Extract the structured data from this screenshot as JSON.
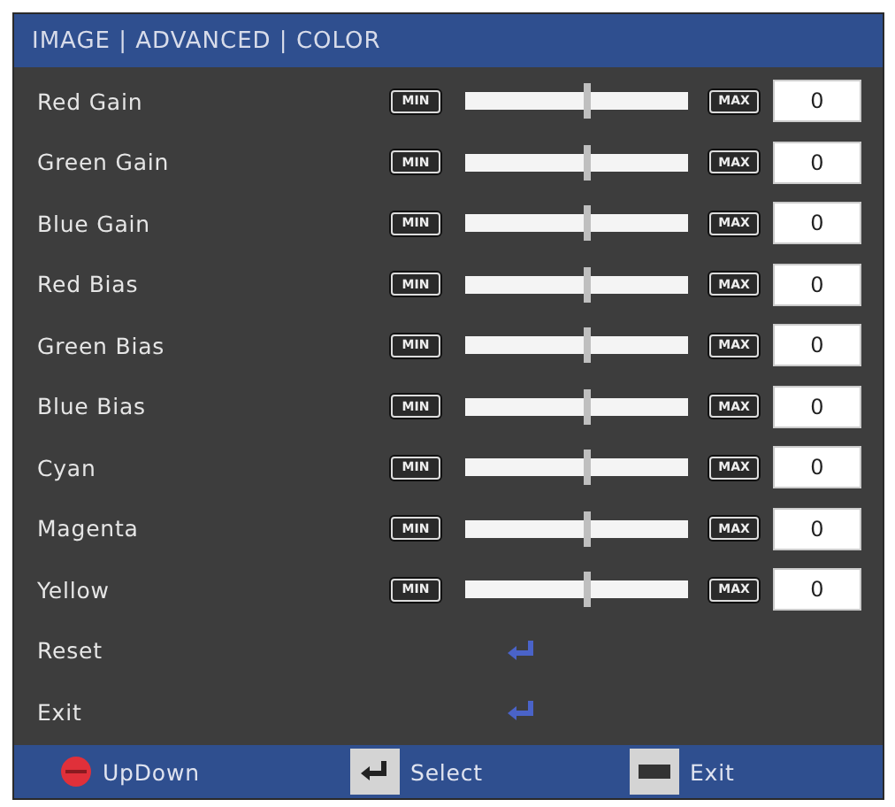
{
  "breadcrumb": "IMAGE | ADVANCED | COLOR",
  "items": [
    {
      "kind": "slider",
      "label": "Red Gain",
      "min_label": "MIN",
      "max_label": "MAX",
      "level": 0.55,
      "value": "0"
    },
    {
      "kind": "slider",
      "label": "Green Gain",
      "min_label": "MIN",
      "max_label": "MAX",
      "level": 0.55,
      "value": "0"
    },
    {
      "kind": "slider",
      "label": "Blue Gain",
      "min_label": "MIN",
      "max_label": "MAX",
      "level": 0.55,
      "value": "0"
    },
    {
      "kind": "slider",
      "label": "Red Bias",
      "min_label": "MIN",
      "max_label": "MAX",
      "level": 0.55,
      "value": "0"
    },
    {
      "kind": "slider",
      "label": "Green Bias",
      "min_label": "MIN",
      "max_label": "MAX",
      "level": 0.55,
      "value": "0"
    },
    {
      "kind": "slider",
      "label": "Blue Bias",
      "min_label": "MIN",
      "max_label": "MAX",
      "level": 0.55,
      "value": "0"
    },
    {
      "kind": "slider",
      "label": "Cyan",
      "min_label": "MIN",
      "max_label": "MAX",
      "level": 0.55,
      "value": "0"
    },
    {
      "kind": "slider",
      "label": "Magenta",
      "min_label": "MIN",
      "max_label": "MAX",
      "level": 0.55,
      "value": "0"
    },
    {
      "kind": "slider",
      "label": "Yellow",
      "min_label": "MIN",
      "max_label": "MAX",
      "level": 0.55,
      "value": "0"
    },
    {
      "kind": "action",
      "label": "Reset"
    },
    {
      "kind": "action",
      "label": "Exit"
    }
  ],
  "footer": [
    {
      "kind": "updown",
      "label": "UpDown"
    },
    {
      "kind": "enter",
      "label": "Select"
    },
    {
      "kind": "menu",
      "label": "Exit"
    }
  ]
}
